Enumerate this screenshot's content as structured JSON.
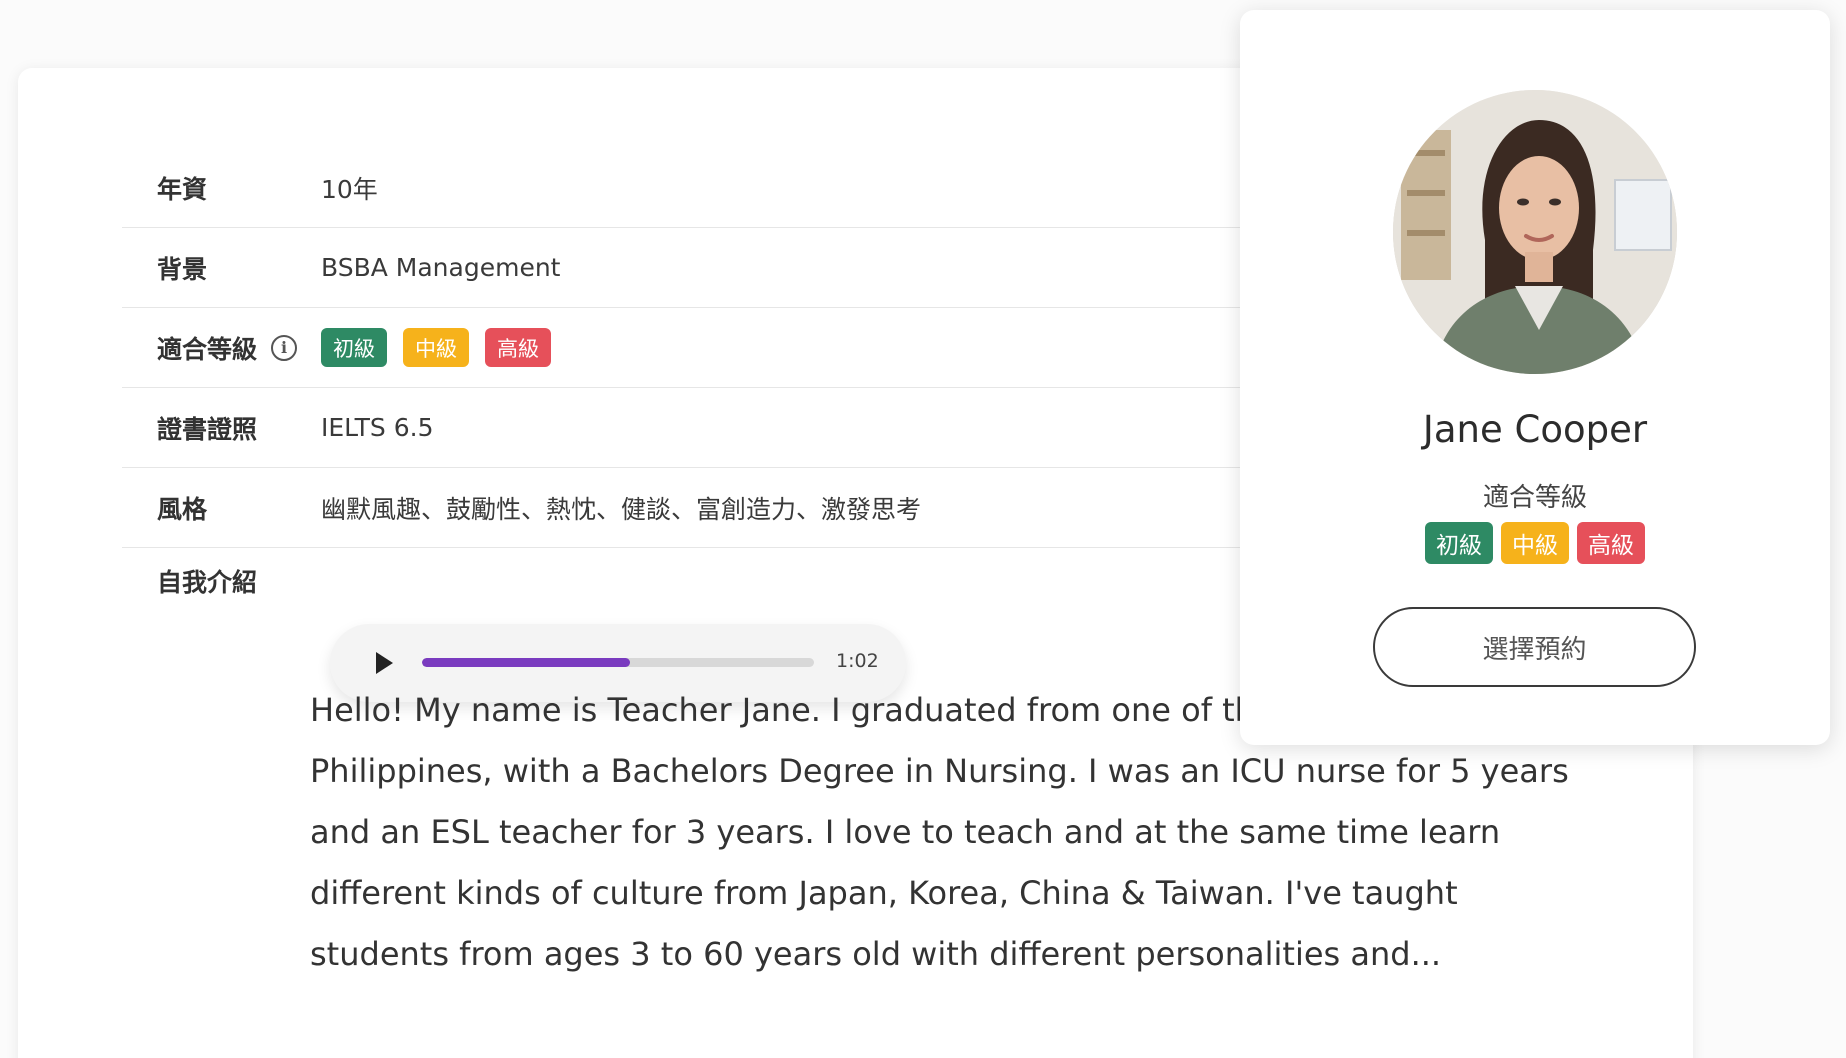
{
  "details": {
    "rows": [
      {
        "label": "年資",
        "value": "10年"
      },
      {
        "label": "背景",
        "value": "BSBA Management"
      },
      {
        "label": "適合等級",
        "value": ""
      },
      {
        "label": "證書證照",
        "value": "IELTS 6.5"
      },
      {
        "label": "風格",
        "value": "幽默風趣、鼓勵性、熱忱、健談、富創造力、激發思考"
      }
    ],
    "levels": [
      "初級",
      "中級",
      "高級"
    ],
    "info_icon_glyph": "i",
    "intro_label": "自我介紹"
  },
  "audio": {
    "time": "1:02",
    "progress_fraction": 0.53
  },
  "bio": "Hello! My name is Teacher Jane. I graduated from one of the b here in the Philippines, with a Bachelors Degree in Nursing. I was an ICU nurse for 5 years and an ESL teacher for 3 years. I love to teach and at the same time learn different kinds of culture from Japan, Korea, China & Taiwan. I've taught students from ages 3 to 60 years old with different personalities and...",
  "profile": {
    "name": "Jane Cooper",
    "level_label": "適合等級",
    "levels": [
      "初級",
      "中級",
      "高級"
    ],
    "book_button": "選擇預約"
  },
  "colors": {
    "beginner": "#2e8a64",
    "intermediate": "#f6b21b",
    "advanced": "#e6505a",
    "audio_progress": "#7a3bbf"
  }
}
